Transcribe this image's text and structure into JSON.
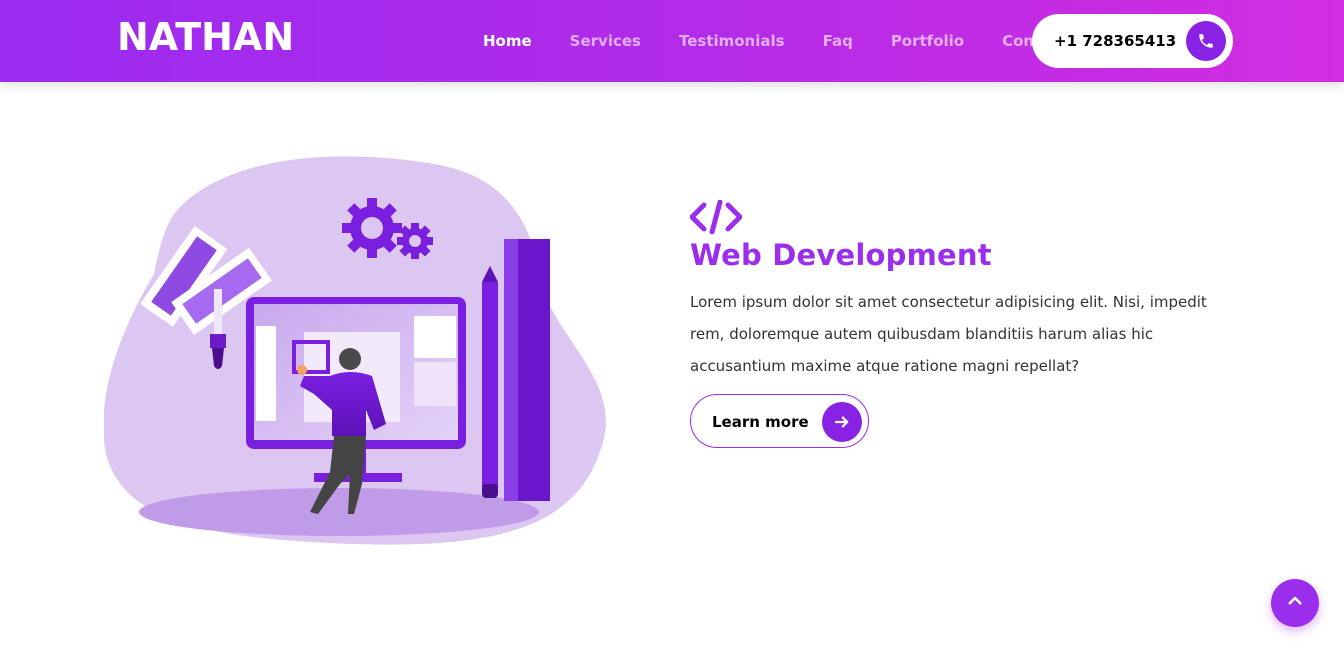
{
  "header": {
    "logo": "NATHAN",
    "nav": [
      {
        "label": "Home",
        "active": true
      },
      {
        "label": "Services",
        "active": false
      },
      {
        "label": "Testimonials",
        "active": false
      },
      {
        "label": "Faq",
        "active": false
      },
      {
        "label": "Portfolio",
        "active": false
      },
      {
        "label": "Contact",
        "active": false
      }
    ],
    "phone": "+1 728365413",
    "phone_icon": "phone-icon"
  },
  "service": {
    "icon": "code-icon",
    "title": "Web Development",
    "description": "Lorem ipsum dolor sit amet consectetur adipisicing elit. Nisi, impedit rem, doloremque autem quibusdam blanditiis harum alias hic accusantium maxime atque ratione magni repellat?",
    "button_label": "Learn more",
    "button_icon": "arrow-right-icon"
  },
  "scroll_top_icon": "chevron-up-icon",
  "colors": {
    "accent": "#9b2ded",
    "accent_dark": "#8a22e6",
    "header_start": "#9b2bf0",
    "header_end": "#d22de0",
    "illustration_bg": "#dcc6f2"
  }
}
